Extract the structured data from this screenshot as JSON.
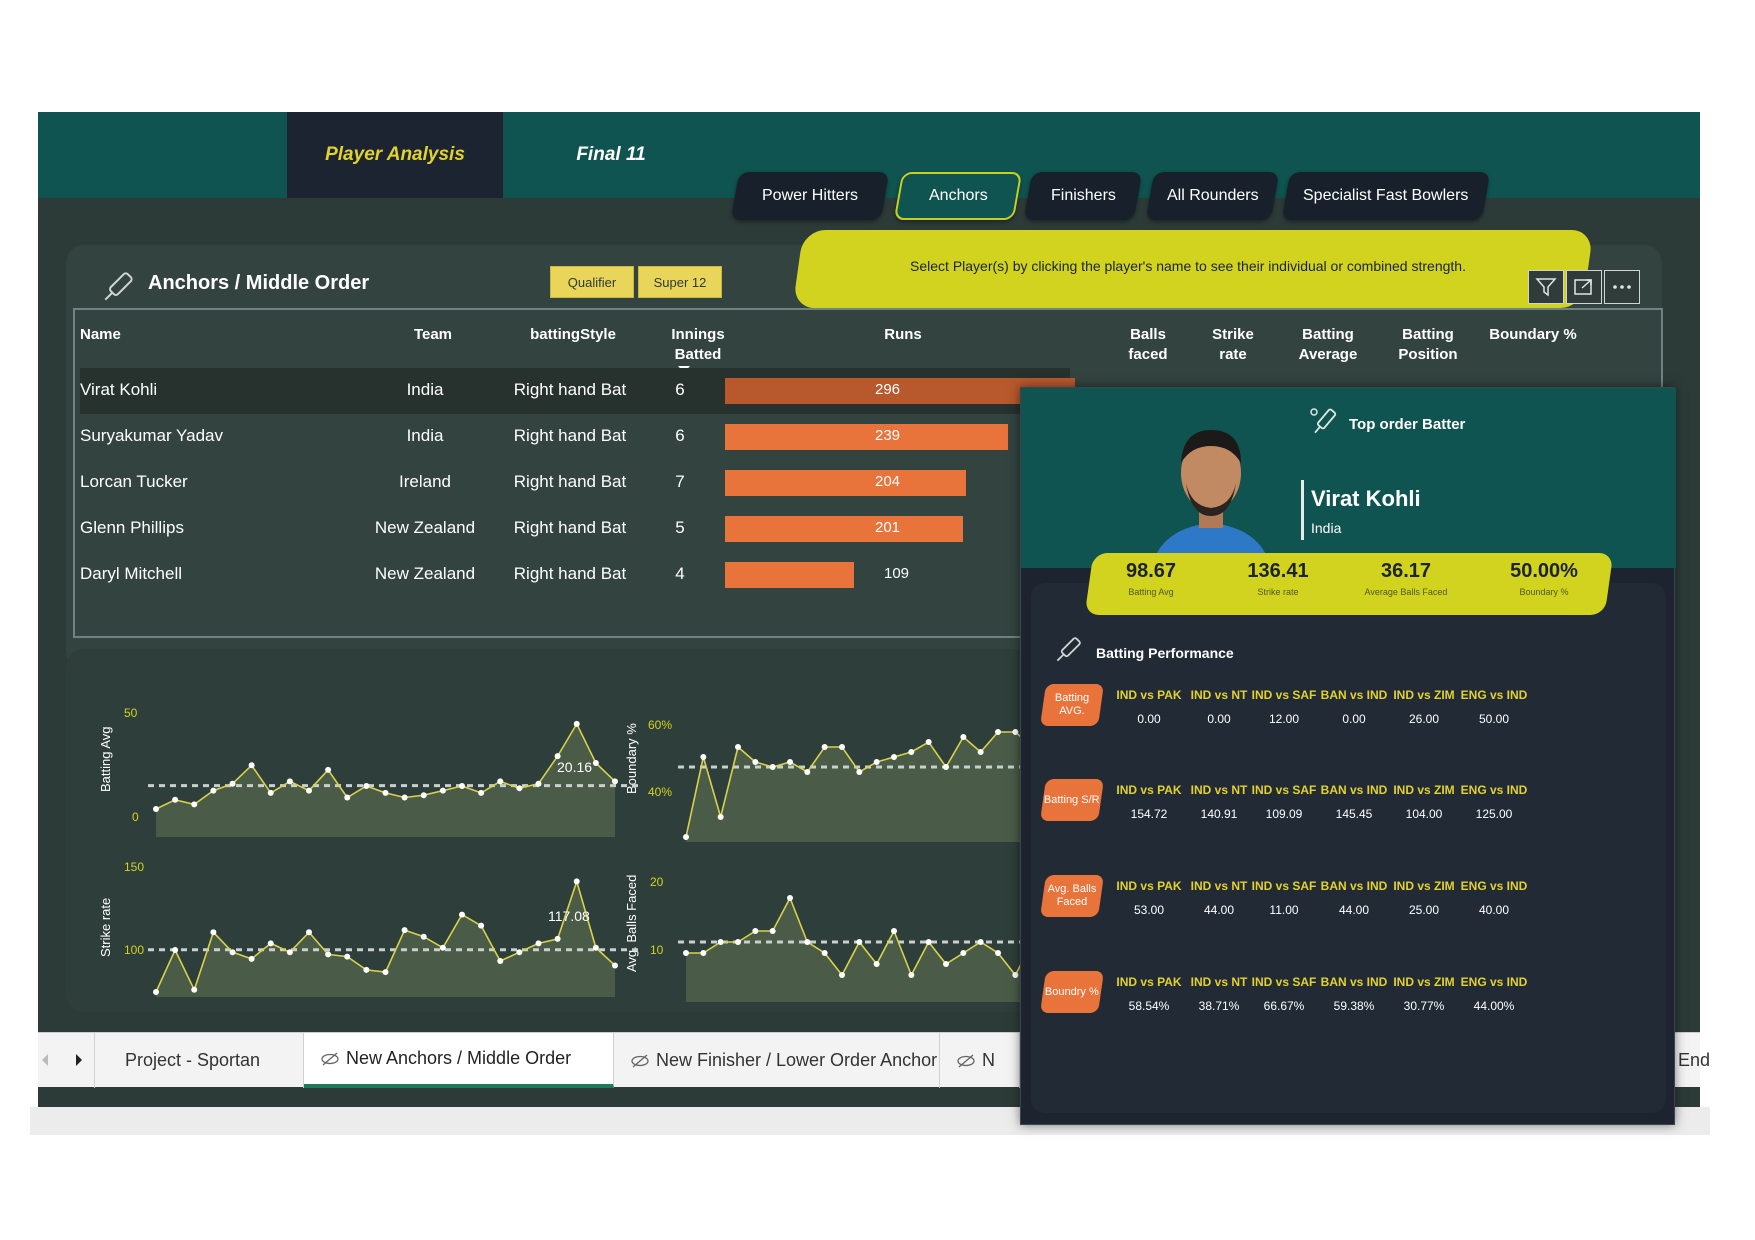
{
  "nav": {
    "tab_player_analysis": "Player Analysis",
    "tab_final11": "Final 11"
  },
  "categories": [
    {
      "label": "Power Hitters"
    },
    {
      "label": "Anchors"
    },
    {
      "label": "Finishers"
    },
    {
      "label": "All Rounders"
    },
    {
      "label": "Specialist Fast Bowlers"
    }
  ],
  "banner": "Select Player(s) by clicking the player's name to see their individual or combined strength.",
  "panel": {
    "title": "Anchors / Middle Order",
    "chips": [
      "Qualifier",
      "Super 12"
    ]
  },
  "table": {
    "headers": {
      "name": "Name",
      "team": "Team",
      "style": "battingStyle",
      "innings": "Innings Batted",
      "runs": "Runs",
      "balls": "Balls faced",
      "sr": "Strike rate",
      "avg": "Batting Average",
      "pos": "Batting Position",
      "boundary": "Boundary %"
    },
    "rows": [
      {
        "name": "Virat Kohli",
        "team": "India",
        "style": "Right hand Bat",
        "innings": "6",
        "runs": 296,
        "runs_label": "296"
      },
      {
        "name": "Suryakumar Yadav",
        "team": "India",
        "style": "Right hand Bat",
        "innings": "6",
        "runs": 239,
        "runs_label": "239"
      },
      {
        "name": "Lorcan Tucker",
        "team": "Ireland",
        "style": "Right hand Bat",
        "innings": "7",
        "runs": 204,
        "runs_label": "204"
      },
      {
        "name": "Glenn Phillips",
        "team": "New Zealand",
        "style": "Right hand Bat",
        "innings": "5",
        "runs": 201,
        "runs_label": "201"
      },
      {
        "name": "Daryl Mitchell",
        "team": "New Zealand",
        "style": "Right hand Bat",
        "innings": "4",
        "runs": 109,
        "runs_label": "109"
      }
    ],
    "runs_max": 296
  },
  "charts": {
    "batting_avg": {
      "ylabel": "Batting Avg",
      "ticks": [
        "50",
        "0"
      ],
      "ref_label": "20.16"
    },
    "boundary": {
      "ylabel": "Boundary %",
      "ticks": [
        "60%",
        "40%"
      ]
    },
    "strike_rate": {
      "ylabel": "Strike rate",
      "ticks": [
        "150",
        "100"
      ],
      "ref_label": "117.08"
    },
    "avg_balls": {
      "ylabel": "Avg. Balls Faced",
      "ticks": [
        "20",
        "10"
      ]
    }
  },
  "chart_data": [
    {
      "type": "line",
      "ylabel": "Batting Avg",
      "ylim": [
        0,
        50
      ],
      "reference": 20.16,
      "values": [
        10,
        14,
        12,
        18,
        21,
        29,
        17,
        22,
        18,
        27,
        15,
        20,
        17,
        15,
        16,
        18,
        20,
        17,
        22,
        19,
        21,
        33,
        47,
        30,
        22
      ]
    },
    {
      "type": "line",
      "ylabel": "Boundary %",
      "ylim": [
        40,
        60
      ],
      "reference": 52,
      "values": [
        38,
        54,
        42,
        56,
        53,
        52,
        53,
        51,
        56,
        56,
        51,
        53,
        54,
        55,
        57,
        52,
        58,
        55,
        59,
        59,
        56,
        53
      ]
    },
    {
      "type": "line",
      "ylabel": "Strike rate",
      "ylim": [
        100,
        150
      ],
      "reference": 117.08,
      "values": [
        98,
        117,
        99,
        125,
        116,
        113,
        120,
        116,
        125,
        115,
        114,
        108,
        107,
        126,
        123,
        118,
        133,
        128,
        112,
        116,
        120,
        122,
        148,
        118,
        110
      ]
    },
    {
      "type": "line",
      "ylabel": "Avg. Balls Faced",
      "ylim": [
        10,
        20
      ],
      "reference": 15,
      "values": [
        14,
        14,
        15,
        15,
        16,
        16,
        19,
        15,
        14,
        12,
        15,
        13,
        16,
        12,
        15,
        13,
        14,
        15,
        14,
        12,
        15,
        15
      ]
    }
  ],
  "tooltip": {
    "role": "Top order Batter",
    "name": "Virat Kohli",
    "team": "India",
    "stats": [
      {
        "value": "98.67",
        "label": "Batting Avg"
      },
      {
        "value": "136.41",
        "label": "Strike rate"
      },
      {
        "value": "36.17",
        "label": "Average Balls Faced"
      },
      {
        "value": "50.00%",
        "label": "Boundary %"
      }
    ],
    "perf_title": "Batting Performance",
    "matches": [
      "IND vs PAK",
      "IND vs NT",
      "IND vs SAF",
      "BAN vs IND",
      "IND vs ZIM",
      "ENG vs IND"
    ],
    "metrics": [
      {
        "label": "Batting AVG.",
        "values": [
          "0.00",
          "0.00",
          "12.00",
          "0.00",
          "26.00",
          "50.00"
        ]
      },
      {
        "label": "Batting S/R",
        "values": [
          "154.72",
          "140.91",
          "109.09",
          "145.45",
          "104.00",
          "125.00"
        ]
      },
      {
        "label": "Avg. Balls Faced",
        "values": [
          "53.00",
          "44.00",
          "11.00",
          "44.00",
          "25.00",
          "40.00"
        ]
      },
      {
        "label": "Boundry %",
        "values": [
          "58.54%",
          "38.71%",
          "66.67%",
          "59.38%",
          "30.77%",
          "44.00%"
        ]
      }
    ]
  },
  "sheet_tabs": {
    "items": [
      "Project - Sportan",
      "New Anchors / Middle Order",
      "New Finisher / Lower Order Anchor",
      "N"
    ],
    "end": "End"
  },
  "colors": {
    "header": "#0f5450",
    "accent": "#d2d31f",
    "bar": "#e8733b",
    "panel": "#2d3b38",
    "tooltip": "#1d2430"
  }
}
